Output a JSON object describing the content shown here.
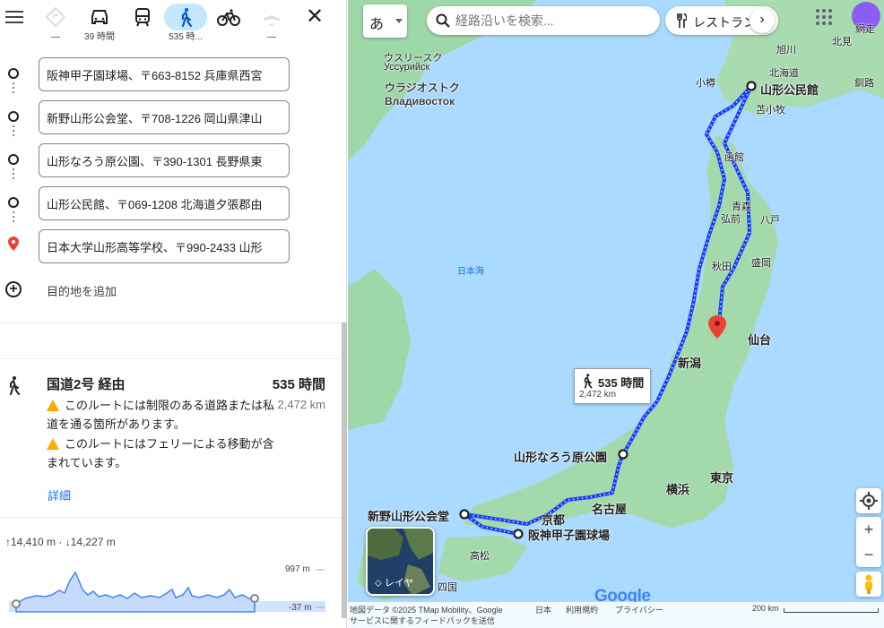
{
  "travel_modes": [
    {
      "name": "best",
      "label": "—"
    },
    {
      "name": "car",
      "label": "39 時間"
    },
    {
      "name": "transit",
      "label": ""
    },
    {
      "name": "walking",
      "label": "535 時..."
    },
    {
      "name": "bicycle",
      "label": ""
    },
    {
      "name": "flight",
      "label": "—"
    }
  ],
  "stops": [
    {
      "value": "阪神甲子園球場、〒663-8152 兵庫県西宮"
    },
    {
      "value": "新野山形公会堂、〒708-1226 岡山県津山"
    },
    {
      "value": "山形なろう原公園、〒390-1301 長野県東"
    },
    {
      "value": "山形公民館、〒069-1208 北海道夕張郡由"
    },
    {
      "value": "日本大学山形高等学校、〒990-2433 山形"
    }
  ],
  "add_destination": "目的地を追加",
  "route": {
    "name": "国道2号 経由",
    "time": "535 時間",
    "distance": "2,472 km",
    "warnings": [
      "このルートには制限のある道路または私道を通る箇所があります。",
      "このルートにはフェリーによる移動が含まれています。"
    ],
    "details_link": "詳細"
  },
  "elevation": {
    "ascent": "↑14,410 m",
    "descent": "↓14,227 m",
    "max_label": "997 m",
    "min_label": "-37 m"
  },
  "map": {
    "ime_label": "あ",
    "search_placeholder": "経路沿いを検索...",
    "chip_label": "レストラン",
    "tooltip_time": "535 時間",
    "tooltip_distance": "2,472 km",
    "layer_label": "レイヤ",
    "labels": {
      "vladivostok_ja": "ウラジオストク",
      "vladivostok_ru": "Владивосток",
      "ussuriysk_ja": "ウスリースク",
      "ussuriysk_ru": "Уссурийск",
      "sea_japan": "日本海",
      "yamagata_komin": "山形公民館",
      "sendai": "仙台",
      "niigata": "新潟",
      "tokyo": "東京",
      "yokohama": "横浜",
      "nagoya": "名古屋",
      "kyoto": "京都",
      "koshien": "阪神甲子園球場",
      "shinno": "新野山形公会堂",
      "narohara": "山形なろう原公園",
      "asahikawa": "旭川",
      "kitami": "北見",
      "abashiri": "網走",
      "kushiro": "釧路",
      "otaru": "小樽",
      "hokkaido": "北海道",
      "tomakomai": "苫小牧",
      "hakodate": "函館",
      "aomori": "青森",
      "hirosaki": "弘前",
      "hachinohe": "八戸",
      "akita": "秋田",
      "morioka": "盛岡",
      "takamatsu": "高松",
      "shikoku": "四国"
    },
    "footer": {
      "data": "地図データ ©2025 TMap Mobility、Google",
      "japan": "日本",
      "terms": "利用規約",
      "privacy": "プライバシー",
      "feedback": "サービスに関するフィードバックを送信",
      "scale": "200 km"
    },
    "logo": "Google",
    "colors": {
      "route": "#1a3cff",
      "water": "#aadaff",
      "land": "#9ed7a8",
      "pin": "#ea4335"
    }
  }
}
